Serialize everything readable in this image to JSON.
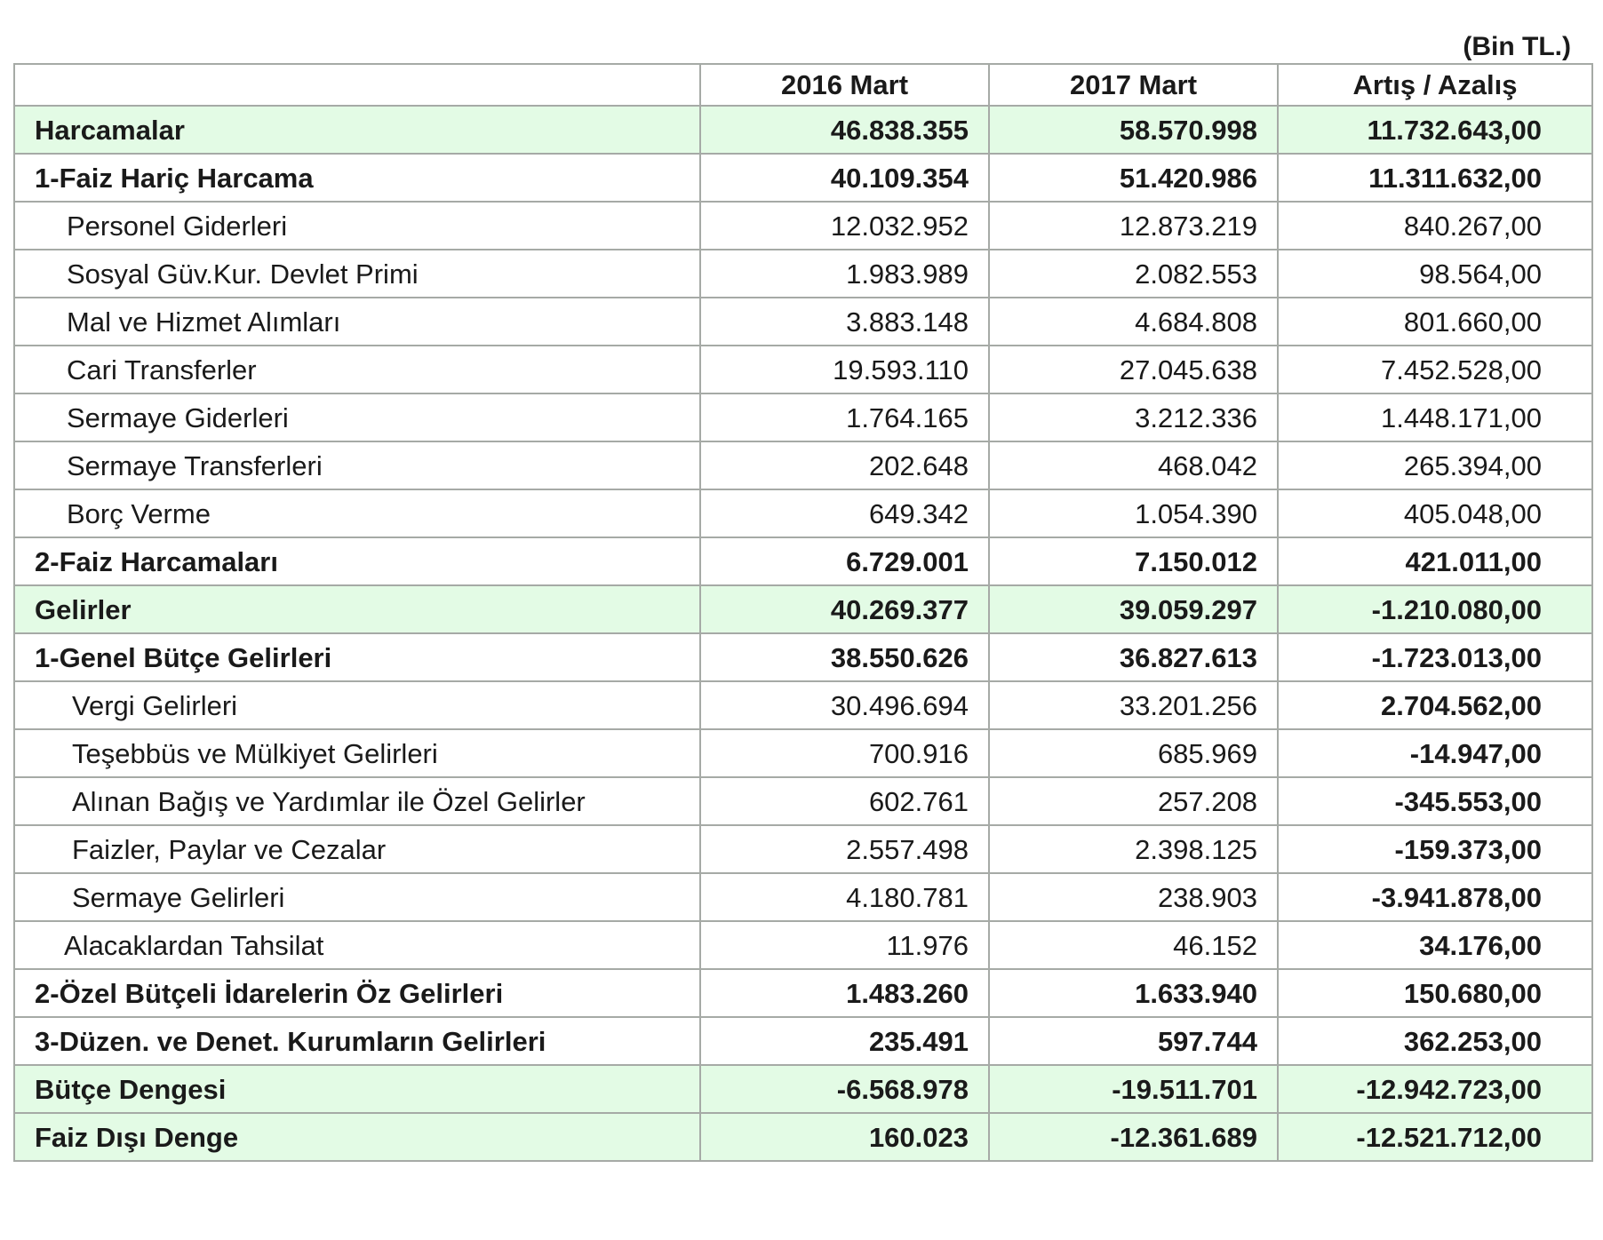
{
  "unit_note": "(Bin TL.)",
  "header": {
    "label": "",
    "col_2016": "2016 Mart",
    "col_2017": "2017 Mart",
    "col_diff": "Artış / Azalış"
  },
  "rows": [
    {
      "label": "Harcamalar",
      "v2016": "46.838.355",
      "v2017": "58.570.998",
      "diff": "11.732.643,00"
    },
    {
      "label": "1-Faiz Hariç Harcama",
      "v2016": "40.109.354",
      "v2017": "51.420.986",
      "diff": "11.311.632,00"
    },
    {
      "label": "Personel Giderleri",
      "v2016": "12.032.952",
      "v2017": "12.873.219",
      "diff": "840.267,00"
    },
    {
      "label": "Sosyal Güv.Kur. Devlet Primi",
      "v2016": "1.983.989",
      "v2017": "2.082.553",
      "diff": "98.564,00"
    },
    {
      "label": "Mal ve Hizmet Alımları",
      "v2016": "3.883.148",
      "v2017": "4.684.808",
      "diff": "801.660,00"
    },
    {
      "label": "Cari Transferler",
      "v2016": "19.593.110",
      "v2017": "27.045.638",
      "diff": "7.452.528,00"
    },
    {
      "label": "Sermaye Giderleri",
      "v2016": "1.764.165",
      "v2017": "3.212.336",
      "diff": "1.448.171,00"
    },
    {
      "label": "Sermaye Transferleri",
      "v2016": "202.648",
      "v2017": "468.042",
      "diff": "265.394,00"
    },
    {
      "label": "Borç Verme",
      "v2016": "649.342",
      "v2017": "1.054.390",
      "diff": "405.048,00"
    },
    {
      "label": "2-Faiz Harcamaları",
      "v2016": "6.729.001",
      "v2017": "7.150.012",
      "diff": "421.011,00"
    },
    {
      "label": "Gelirler",
      "v2016": "40.269.377",
      "v2017": "39.059.297",
      "diff": "-1.210.080,00"
    },
    {
      "label": "1-Genel Bütçe Gelirleri",
      "v2016": "38.550.626",
      "v2017": "36.827.613",
      "diff": "-1.723.013,00"
    },
    {
      "label": "Vergi Gelirleri",
      "v2016": "30.496.694",
      "v2017": "33.201.256",
      "diff": "2.704.562,00"
    },
    {
      "label": "Teşebbüs ve Mülkiyet Gelirleri",
      "v2016": "700.916",
      "v2017": "685.969",
      "diff": "-14.947,00"
    },
    {
      "label": "Alınan Bağış ve Yardımlar ile Özel Gelirler",
      "v2016": "602.761",
      "v2017": "257.208",
      "diff": "-345.553,00"
    },
    {
      "label": "Faizler, Paylar ve Cezalar",
      "v2016": "2.557.498",
      "v2017": "2.398.125",
      "diff": "-159.373,00"
    },
    {
      "label": "Sermaye Gelirleri",
      "v2016": "4.180.781",
      "v2017": "238.903",
      "diff": "-3.941.878,00"
    },
    {
      "label": "Alacaklardan Tahsilat",
      "v2016": "11.976",
      "v2017": "46.152",
      "diff": "34.176,00"
    },
    {
      "label": "2-Özel Bütçeli İdarelerin Öz  Gelirleri",
      "v2016": "1.483.260",
      "v2017": "1.633.940",
      "diff": "150.680,00"
    },
    {
      "label": "3-Düzen. ve Denet. Kurumların Gelirleri",
      "v2016": "235.491",
      "v2017": "597.744",
      "diff": "362.253,00"
    },
    {
      "label": "Bütçe Dengesi",
      "v2016": "-6.568.978",
      "v2017": "-19.511.701",
      "diff": "-12.942.723,00"
    },
    {
      "label": "Faiz Dışı Denge",
      "v2016": "160.023",
      "v2017": "-12.361.689",
      "diff": "-12.521.712,00"
    }
  ]
}
